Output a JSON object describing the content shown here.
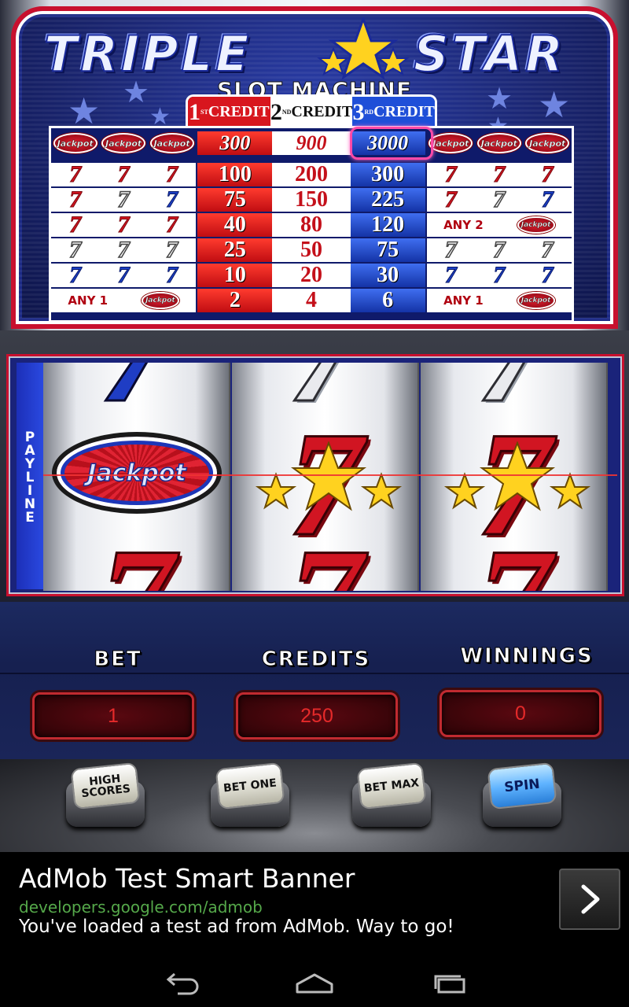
{
  "header": {
    "title_left": "TRIPLE",
    "title_right": "STAR",
    "subtitle": "SLOT MACHINE",
    "credit_tabs": [
      {
        "num": "1",
        "sup": "ST",
        "label": "CREDIT"
      },
      {
        "num": "2",
        "sup": "ND",
        "label": "CREDIT"
      },
      {
        "num": "3",
        "sup": "RD",
        "label": "CREDIT"
      }
    ]
  },
  "paytable": {
    "jackpot_label": "Jackpot",
    "top_row": [
      "300",
      "900",
      "3000"
    ],
    "rows": [
      {
        "values": [
          "100",
          "200",
          "300"
        ],
        "left": "star7",
        "right": "star7"
      },
      {
        "values": [
          "75",
          "150",
          "225"
        ],
        "left": "mixed7",
        "right": "mixed7"
      },
      {
        "values": [
          "40",
          "80",
          "120"
        ],
        "left": "red7",
        "right_text": "ANY 2"
      },
      {
        "values": [
          "25",
          "50",
          "75"
        ],
        "left": "white7",
        "right": "white7"
      },
      {
        "values": [
          "10",
          "20",
          "30"
        ],
        "left": "blue7",
        "right": "blue7"
      },
      {
        "values": [
          "2",
          "4",
          "6"
        ],
        "left_text": "ANY 1",
        "right_text": "ANY 1"
      }
    ]
  },
  "reels": {
    "payline_label": "PAYLINE",
    "jackpot_label": "Jackpot"
  },
  "stats": {
    "bet_label": "BET",
    "credits_label": "CREDITS",
    "winnings_label": "WINNINGS",
    "bet_value": "1",
    "credits_value": "250",
    "winnings_value": "0"
  },
  "buttons": {
    "high_scores": "HIGH SCORES",
    "bet_one": "BET ONE",
    "bet_max": "BET MAX",
    "spin": "SPIN"
  },
  "ad": {
    "title": "AdMob Test Smart Banner",
    "url": "developers.google.com/admob",
    "description": "You've loaded a test ad from AdMob. Way to go!"
  },
  "icons": {
    "back": "back-icon",
    "home": "home-icon",
    "recents": "recents-icon",
    "ad_arrow": "chevron-right-icon"
  }
}
